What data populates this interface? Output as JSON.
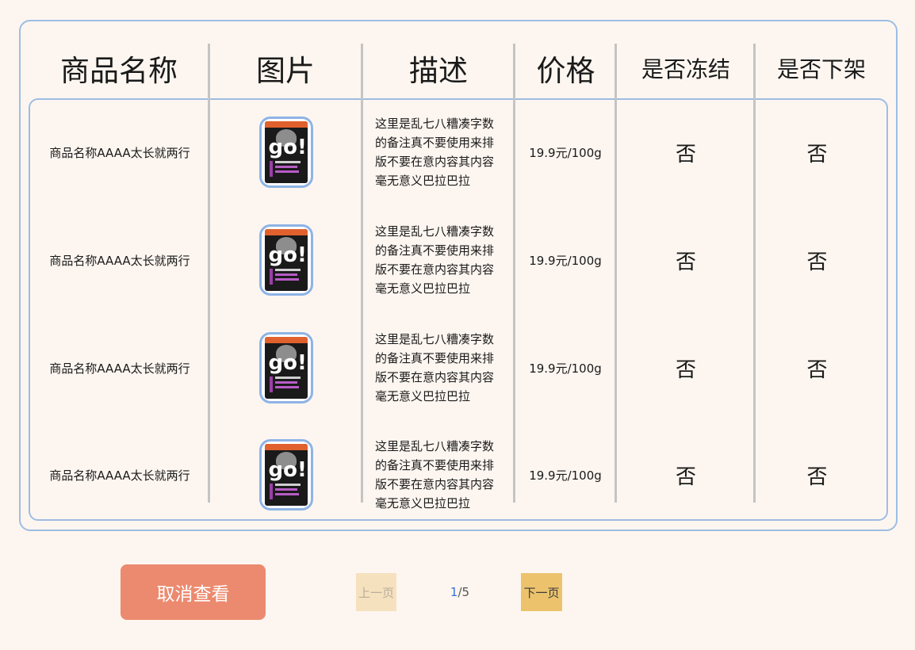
{
  "table": {
    "headers": {
      "name": "商品名称",
      "image": "图片",
      "description": "描述",
      "price": "价格",
      "frozen": "是否冻结",
      "offshelf": "是否下架"
    },
    "rows": [
      {
        "name": "商品名称AAAA太长就两行",
        "description": "这里是乱七八糟凑字数的备注真不要使用来排版不要在意内容其内容毫无意义巴拉巴拉",
        "price": "19.9元/100g",
        "frozen": "否",
        "offshelf": "否",
        "image_icon": "pet-food-bag-icon"
      },
      {
        "name": "商品名称AAAA太长就两行",
        "description": "这里是乱七八糟凑字数的备注真不要使用来排版不要在意内容其内容毫无意义巴拉巴拉",
        "price": "19.9元/100g",
        "frozen": "否",
        "offshelf": "否",
        "image_icon": "pet-food-bag-icon"
      },
      {
        "name": "商品名称AAAA太长就两行",
        "description": "这里是乱七八糟凑字数的备注真不要使用来排版不要在意内容其内容毫无意义巴拉巴拉",
        "price": "19.9元/100g",
        "frozen": "否",
        "offshelf": "否",
        "image_icon": "pet-food-bag-icon"
      },
      {
        "name": "商品名称AAAA太长就两行",
        "description": "这里是乱七八糟凑字数的备注真不要使用来排版不要在意内容其内容毫无意义巴拉巴拉",
        "price": "19.9元/100g",
        "frozen": "否",
        "offshelf": "否",
        "image_icon": "pet-food-bag-icon"
      }
    ],
    "package_logo": "go!"
  },
  "footer": {
    "cancel_label": "取消查看",
    "prev_label": "上一页",
    "next_label": "下一页",
    "current_page": "1",
    "page_separator": "/",
    "total_pages": "5"
  },
  "colors": {
    "background": "#fdf6f0",
    "border": "#9dbde3",
    "cancel_button": "#ec8a6f",
    "prev_button_disabled": "#f6e1be",
    "next_button": "#ecc36c",
    "current_page": "#3a6fd8"
  }
}
